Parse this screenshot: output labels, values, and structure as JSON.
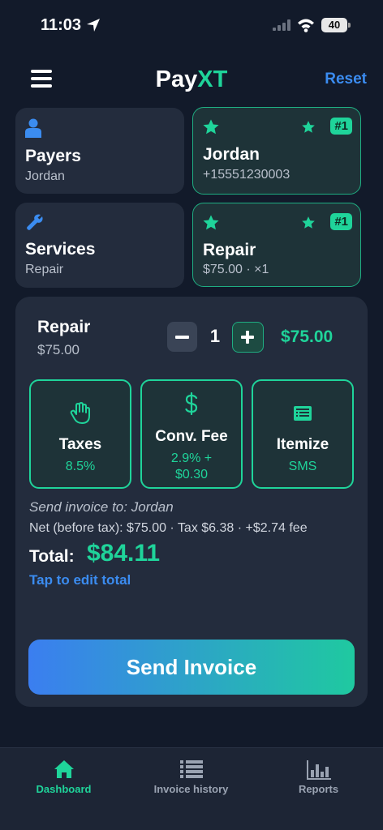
{
  "status": {
    "time": "11:03",
    "battery": "40"
  },
  "header": {
    "brand_pay": "Pay",
    "brand_xt": "XT",
    "reset_label": "Reset"
  },
  "cards": {
    "payers": {
      "title": "Payers",
      "value": "Jordan"
    },
    "payer_selected": {
      "name": "Jordan",
      "phone": "+15551230003",
      "badge": "#1"
    },
    "services": {
      "title": "Services",
      "value": "Repair"
    },
    "service_selected": {
      "name": "Repair",
      "detail": "$75.00 · ×1",
      "badge": "#1"
    }
  },
  "line_item": {
    "name": "Repair",
    "price": "$75.00",
    "quantity": "1",
    "total": "$75.00"
  },
  "options": {
    "taxes": {
      "title": "Taxes",
      "value": "8.5%"
    },
    "conv_fee": {
      "title": "Conv. Fee",
      "value_line1": "2.9% +",
      "value_line2": "$0.30"
    },
    "itemize": {
      "title": "Itemize",
      "value": "SMS"
    }
  },
  "summary": {
    "send_to": "Send invoice to: Jordan",
    "net_line": "Net (before tax): $75.00 · Tax $6.38 · +$2.74 fee",
    "total_label": "Total:",
    "total_value": "$84.11",
    "edit_total": "Tap to edit total"
  },
  "send_button": "Send Invoice",
  "tabs": [
    {
      "label": "Dashboard",
      "active": true
    },
    {
      "label": "Invoice history",
      "active": false
    },
    {
      "label": "Reports",
      "active": false
    }
  ],
  "colors": {
    "accent_green": "#1fd49a",
    "accent_blue": "#3b8cf0",
    "background": "#121a2a",
    "card": "#232c3d"
  }
}
